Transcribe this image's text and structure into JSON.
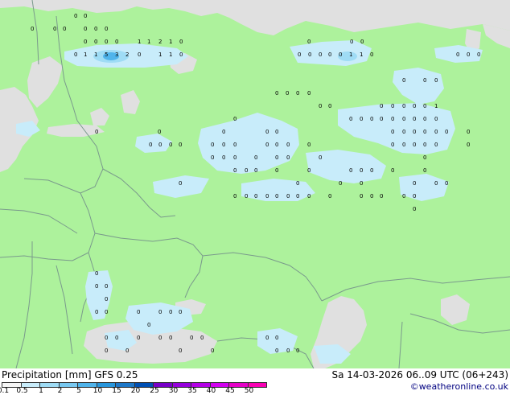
{
  "legend": {
    "title": "Precipitation [mm]  GFS 0.25",
    "datetime": "Sa 14-03-2026 06..09 UTC (06+243)",
    "credit": "©weatheronline.co.uk",
    "ticks": [
      "0.1",
      "0.5",
      "1",
      "2",
      "5",
      "10",
      "15",
      "20",
      "25",
      "30",
      "35",
      "40",
      "45",
      "50"
    ],
    "scale_colors": [
      "#f5f5f5",
      "#c8ecfa",
      "#9fdcf5",
      "#78c8f0",
      "#50b4eb",
      "#2896dc",
      "#1e78c8",
      "#0050b4",
      "#7800c8",
      "#9600dc",
      "#b400e6",
      "#d200f0",
      "#e600c8",
      "#fa00b4"
    ]
  },
  "map": {
    "colors": {
      "land": "#adf29c",
      "sea": "#e0e0e0",
      "precip_light": "#c8ecfa",
      "precip_mid": "#9fdcf5",
      "precip_heavy": "#50b4eb",
      "border": "#7a9a8c"
    },
    "value_labels": [
      "0",
      "0",
      "0",
      "0",
      "0",
      "0",
      "0",
      "0",
      "0",
      "0",
      "0",
      "0",
      "1",
      "1",
      "2",
      "1",
      "0",
      "0",
      "1",
      "1",
      "5",
      "3",
      "2",
      "0",
      "1",
      "1",
      "0",
      "0",
      "0",
      "0",
      "0",
      "0",
      "1",
      "1",
      "0",
      "0",
      "0",
      "0",
      "0",
      "0",
      "0",
      "0",
      "0",
      "0",
      "0",
      "0",
      "0",
      "0",
      "0",
      "0",
      "0",
      "0",
      "1",
      "0",
      "0",
      "0",
      "0",
      "0",
      "0",
      "0",
      "0",
      "0",
      "0",
      "0",
      "0",
      "0",
      "0",
      "0",
      "0",
      "0",
      "0"
    ]
  }
}
